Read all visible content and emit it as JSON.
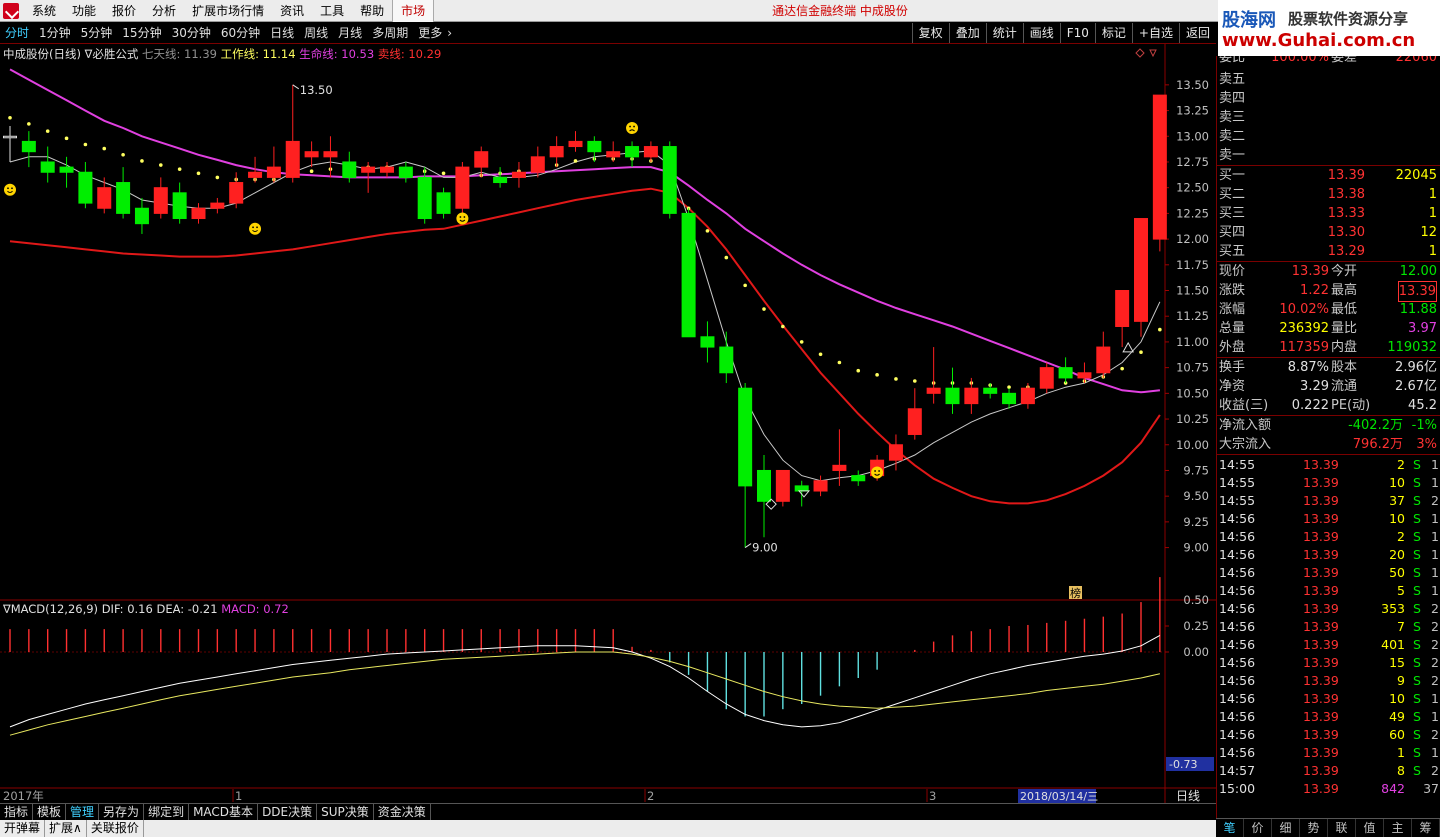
{
  "menu": {
    "items": [
      "系统",
      "功能",
      "报价",
      "分析",
      "扩展市场行情",
      "资讯",
      "工具",
      "帮助",
      "市场"
    ],
    "active": "市场",
    "title": "通达信金融终端  中成股份"
  },
  "watermark": {
    "logo": "股海网",
    "slogan": "股票软件资源分享",
    "url": "www.Guhai.com.cn"
  },
  "periods": [
    "分时",
    "1分钟",
    "5分钟",
    "15分钟",
    "30分钟",
    "60分钟",
    "日线",
    "周线",
    "月线",
    "多周期",
    "更多"
  ],
  "period_active": "分时",
  "tools": [
    "复权",
    "叠加",
    "统计",
    "画线",
    "F10",
    "标记",
    "+自选",
    "返回"
  ],
  "main_chart": {
    "stock": "中成股份(日线)",
    "formula": "∇必胜公式",
    "qitian": "七天线: 11.39",
    "gongzuo": "工作线: 11.14",
    "shengming": "生命线: 10.53",
    "maixian": "卖线: 10.29",
    "high_label": "13.50",
    "low_label": "9.00",
    "ylim": [
      8.5,
      13.8
    ],
    "yticks": [
      9.0,
      9.25,
      9.5,
      9.75,
      10.0,
      10.25,
      10.5,
      10.75,
      11.0,
      11.25,
      11.5,
      11.75,
      12.0,
      12.25,
      12.5,
      12.75,
      13.0,
      13.25,
      13.5
    ],
    "ytick_labels": [
      "9.00",
      "9.25",
      "9.50",
      "9.75",
      "10.00",
      "10.25",
      "10.50",
      "10.75",
      "11.00",
      "11.25",
      "11.50",
      "11.75",
      "12.00",
      "12.25",
      "12.50",
      "12.75",
      "13.00",
      "13.25",
      "13.50"
    ],
    "mark_label": "榜"
  },
  "macd": {
    "title": "∇MACD(12,26,9)",
    "dif": "DIF: 0.16",
    "dea": "DEA: -0.21",
    "macd": "MACD: 0.72",
    "ytick_labels": [
      "0.50",
      "0.25",
      "0.00"
    ],
    "cursor_label": "-0.73"
  },
  "xaxis": {
    "year_label": "2017年",
    "month_labels": [
      "1",
      "2",
      "3"
    ],
    "date_label": "2018/03/14/三",
    "period_label": "日线"
  },
  "chart_data": {
    "type": "candlestick",
    "colors": {
      "up": "#ff2020",
      "down": "#00ee00",
      "qitian": "#ffff60",
      "gongzuo": "#c8c8c8",
      "shengming": "#e040e0",
      "maixian": "#e01818"
    },
    "candles": [
      [
        13.0,
        13.0,
        13.1,
        12.75
      ],
      [
        12.95,
        12.85,
        13.05,
        12.7
      ],
      [
        12.75,
        12.65,
        12.9,
        12.55
      ],
      [
        12.7,
        12.65,
        12.8,
        12.5
      ],
      [
        12.65,
        12.35,
        12.75,
        12.3
      ],
      [
        12.3,
        12.5,
        12.6,
        12.25
      ],
      [
        12.55,
        12.25,
        12.7,
        12.2
      ],
      [
        12.3,
        12.15,
        12.4,
        12.05
      ],
      [
        12.25,
        12.5,
        12.6,
        12.2
      ],
      [
        12.45,
        12.2,
        12.55,
        12.15
      ],
      [
        12.2,
        12.3,
        12.35,
        12.15
      ],
      [
        12.3,
        12.35,
        12.4,
        12.25
      ],
      [
        12.35,
        12.55,
        12.65,
        12.3
      ],
      [
        12.6,
        12.65,
        12.8,
        12.55
      ],
      [
        12.6,
        12.7,
        12.9,
        12.55
      ],
      [
        12.6,
        12.95,
        13.5,
        12.55
      ],
      [
        12.8,
        12.85,
        12.95,
        12.7
      ],
      [
        12.8,
        12.85,
        13.0,
        12.6
      ],
      [
        12.75,
        12.6,
        12.85,
        12.55
      ],
      [
        12.65,
        12.7,
        12.75,
        12.45
      ],
      [
        12.65,
        12.7,
        12.75,
        12.6
      ],
      [
        12.7,
        12.6,
        12.75,
        12.55
      ],
      [
        12.6,
        12.2,
        12.7,
        12.15
      ],
      [
        12.45,
        12.25,
        12.5,
        12.2
      ],
      [
        12.3,
        12.7,
        12.75,
        12.25
      ],
      [
        12.7,
        12.85,
        12.9,
        12.6
      ],
      [
        12.6,
        12.55,
        12.7,
        12.5
      ],
      [
        12.6,
        12.65,
        12.75,
        12.5
      ],
      [
        12.65,
        12.8,
        12.9,
        12.6
      ],
      [
        12.8,
        12.9,
        13.0,
        12.7
      ],
      [
        12.9,
        12.95,
        13.05,
        12.85
      ],
      [
        12.95,
        12.85,
        13.0,
        12.75
      ],
      [
        12.8,
        12.85,
        12.95,
        12.75
      ],
      [
        12.9,
        12.8,
        12.95,
        12.7
      ],
      [
        12.8,
        12.9,
        12.95,
        12.75
      ],
      [
        12.9,
        12.25,
        12.95,
        12.2
      ],
      [
        12.25,
        11.05,
        12.3,
        11.05
      ],
      [
        11.05,
        10.95,
        11.2,
        10.8
      ],
      [
        10.95,
        10.7,
        11.1,
        10.6
      ],
      [
        10.55,
        9.6,
        10.6,
        9.0
      ],
      [
        9.75,
        9.45,
        9.9,
        9.1
      ],
      [
        9.45,
        9.75,
        9.75,
        9.4
      ],
      [
        9.6,
        9.55,
        9.65,
        9.4
      ],
      [
        9.55,
        9.65,
        9.7,
        9.5
      ],
      [
        9.75,
        9.8,
        10.15,
        9.6
      ],
      [
        9.7,
        9.65,
        9.75,
        9.6
      ],
      [
        9.7,
        9.85,
        9.9,
        9.65
      ],
      [
        9.85,
        10.0,
        10.1,
        9.75
      ],
      [
        10.1,
        10.35,
        10.55,
        10.05
      ],
      [
        10.5,
        10.55,
        10.95,
        10.4
      ],
      [
        10.55,
        10.4,
        10.75,
        10.3
      ],
      [
        10.4,
        10.55,
        10.65,
        10.3
      ],
      [
        10.55,
        10.5,
        10.6,
        10.45
      ],
      [
        10.5,
        10.4,
        10.55,
        10.35
      ],
      [
        10.4,
        10.55,
        10.6,
        10.35
      ],
      [
        10.55,
        10.75,
        10.8,
        10.5
      ],
      [
        10.75,
        10.65,
        10.85,
        10.6
      ],
      [
        10.65,
        10.7,
        10.8,
        10.6
      ],
      [
        10.7,
        10.95,
        11.1,
        10.65
      ],
      [
        11.15,
        11.5,
        11.5,
        10.95
      ],
      [
        11.2,
        12.2,
        12.2,
        11.05
      ],
      [
        12.0,
        13.4,
        13.4,
        11.88
      ]
    ],
    "qitian": [
      13.18,
      13.12,
      13.05,
      12.98,
      12.92,
      12.88,
      12.82,
      12.76,
      12.72,
      12.68,
      12.64,
      12.6,
      12.58,
      12.58,
      12.58,
      12.62,
      12.66,
      12.68,
      12.7,
      12.7,
      12.7,
      12.68,
      12.66,
      12.64,
      12.62,
      12.62,
      12.64,
      12.66,
      12.68,
      12.72,
      12.76,
      12.78,
      12.78,
      12.78,
      12.76,
      12.6,
      12.3,
      12.08,
      11.82,
      11.55,
      11.32,
      11.15,
      11.0,
      10.88,
      10.8,
      10.72,
      10.68,
      10.64,
      10.62,
      10.6,
      10.6,
      10.6,
      10.58,
      10.56,
      10.56,
      10.58,
      10.6,
      10.62,
      10.66,
      10.74,
      10.9,
      11.12
    ],
    "gongzuo": [
      12.75,
      12.8,
      12.8,
      12.72,
      12.62,
      12.55,
      12.48,
      12.38,
      12.35,
      12.32,
      12.3,
      12.3,
      12.35,
      12.45,
      12.55,
      12.65,
      12.72,
      12.75,
      12.72,
      12.68,
      12.7,
      12.75,
      12.7,
      12.6,
      12.6,
      12.65,
      12.6,
      12.6,
      12.62,
      12.68,
      12.75,
      12.8,
      12.82,
      12.84,
      12.86,
      12.72,
      12.2,
      11.6,
      11.0,
      10.45,
      10.1,
      9.85,
      9.7,
      9.65,
      9.68,
      9.7,
      9.75,
      9.82,
      9.9,
      10.02,
      10.12,
      10.22,
      10.3,
      10.36,
      10.42,
      10.5,
      10.56,
      10.6,
      10.68,
      10.8,
      11.0,
      11.39
    ],
    "shengming": [
      13.65,
      13.55,
      13.45,
      13.35,
      13.25,
      13.15,
      13.08,
      13.0,
      12.94,
      12.88,
      12.82,
      12.77,
      12.72,
      12.68,
      12.65,
      12.63,
      12.62,
      12.61,
      12.6,
      12.6,
      12.6,
      12.6,
      12.61,
      12.61,
      12.61,
      12.62,
      12.63,
      12.64,
      12.65,
      12.66,
      12.67,
      12.68,
      12.69,
      12.7,
      12.7,
      12.65,
      12.52,
      12.38,
      12.25,
      12.1,
      11.98,
      11.86,
      11.75,
      11.65,
      11.56,
      11.48,
      11.4,
      11.33,
      11.27,
      11.21,
      11.15,
      11.08,
      11.01,
      10.94,
      10.87,
      10.8,
      10.73,
      10.65,
      10.59,
      10.53,
      10.51,
      10.53
    ],
    "maixian": [
      11.98,
      11.96,
      11.94,
      11.92,
      11.9,
      11.88,
      11.86,
      11.85,
      11.84,
      11.83,
      11.83,
      11.83,
      11.84,
      11.86,
      11.88,
      11.9,
      11.93,
      11.96,
      11.99,
      12.02,
      12.05,
      12.07,
      12.09,
      12.1,
      12.14,
      12.18,
      12.22,
      12.26,
      12.3,
      12.34,
      12.38,
      12.41,
      12.44,
      12.47,
      12.49,
      12.45,
      12.3,
      12.12,
      11.9,
      11.65,
      11.4,
      11.16,
      10.93,
      10.7,
      10.5,
      10.3,
      10.12,
      9.95,
      9.8,
      9.67,
      9.58,
      9.5,
      9.45,
      9.43,
      9.43,
      9.46,
      9.52,
      9.6,
      9.7,
      9.83,
      10.02,
      10.29
    ],
    "macd_bars": [
      0.22,
      0.22,
      0.22,
      0.22,
      0.22,
      0.22,
      0.22,
      0.22,
      0.22,
      0.22,
      0.22,
      0.22,
      0.22,
      0.22,
      0.22,
      0.22,
      0.22,
      0.22,
      0.22,
      0.22,
      0.22,
      0.22,
      0.22,
      0.22,
      0.22,
      0.22,
      0.22,
      0.22,
      0.22,
      0.22,
      0.22,
      0.22,
      0.22,
      0.05,
      0.02,
      -0.1,
      -0.22,
      -0.38,
      -0.55,
      -0.62,
      -0.62,
      -0.55,
      -0.5,
      -0.42,
      -0.33,
      -0.25,
      -0.17,
      0.0,
      0.02,
      0.1,
      0.16,
      0.2,
      0.22,
      0.25,
      0.26,
      0.28,
      0.3,
      0.32,
      0.34,
      0.37,
      0.48,
      0.72
    ],
    "dif": [
      -0.72,
      -0.65,
      -0.6,
      -0.55,
      -0.5,
      -0.46,
      -0.42,
      -0.38,
      -0.34,
      -0.3,
      -0.27,
      -0.24,
      -0.21,
      -0.18,
      -0.15,
      -0.12,
      -0.1,
      -0.08,
      -0.06,
      -0.04,
      -0.02,
      -0.01,
      0.0,
      0.01,
      0.02,
      0.03,
      0.04,
      0.05,
      0.06,
      0.06,
      0.06,
      0.05,
      0.04,
      0.0,
      -0.06,
      -0.14,
      -0.25,
      -0.38,
      -0.5,
      -0.6,
      -0.66,
      -0.7,
      -0.72,
      -0.71,
      -0.68,
      -0.62,
      -0.56,
      -0.5,
      -0.44,
      -0.38,
      -0.32,
      -0.26,
      -0.21,
      -0.17,
      -0.13,
      -0.1,
      -0.07,
      -0.04,
      -0.02,
      0.01,
      0.06,
      0.16
    ],
    "dea": [
      -0.8,
      -0.75,
      -0.7,
      -0.66,
      -0.62,
      -0.58,
      -0.54,
      -0.5,
      -0.46,
      -0.42,
      -0.39,
      -0.36,
      -0.33,
      -0.3,
      -0.27,
      -0.24,
      -0.22,
      -0.2,
      -0.17,
      -0.15,
      -0.13,
      -0.11,
      -0.09,
      -0.07,
      -0.06,
      -0.05,
      -0.04,
      -0.03,
      -0.02,
      -0.01,
      0.0,
      0.0,
      0.0,
      -0.02,
      -0.05,
      -0.09,
      -0.14,
      -0.2,
      -0.26,
      -0.32,
      -0.38,
      -0.43,
      -0.47,
      -0.5,
      -0.52,
      -0.53,
      -0.54,
      -0.53,
      -0.52,
      -0.5,
      -0.48,
      -0.46,
      -0.44,
      -0.42,
      -0.4,
      -0.37,
      -0.35,
      -0.33,
      -0.31,
      -0.28,
      -0.25,
      -0.21
    ],
    "smileys": [
      {
        "i": 0,
        "v": 12.48
      },
      {
        "i": 13,
        "v": 12.1
      },
      {
        "i": 24,
        "v": 12.2
      },
      {
        "i": 33,
        "v": 13.08
      },
      {
        "i": 46,
        "v": 9.73
      }
    ]
  },
  "quote": {
    "weibi": {
      "label": "委比",
      "value": "100.00%",
      "label2": "委差",
      "value2": "22060"
    },
    "sell": [
      {
        "label": "卖五",
        "price": "",
        "vol": ""
      },
      {
        "label": "卖四",
        "price": "",
        "vol": ""
      },
      {
        "label": "卖三",
        "price": "",
        "vol": ""
      },
      {
        "label": "卖二",
        "price": "",
        "vol": ""
      },
      {
        "label": "卖一",
        "price": "",
        "vol": ""
      }
    ],
    "buy": [
      {
        "label": "买一",
        "price": "13.39",
        "vol": "22045"
      },
      {
        "label": "买二",
        "price": "13.38",
        "vol": "1"
      },
      {
        "label": "买三",
        "price": "13.33",
        "vol": "1"
      },
      {
        "label": "买四",
        "price": "13.30",
        "vol": "12"
      },
      {
        "label": "买五",
        "price": "13.29",
        "vol": "1"
      }
    ],
    "stats": [
      {
        "l1": "现价",
        "v1": "13.39",
        "c1": "red",
        "l2": "今开",
        "v2": "12.00",
        "c2": "green"
      },
      {
        "l1": "涨跌",
        "v1": "1.22",
        "c1": "red",
        "l2": "最高",
        "v2": "13.39",
        "c2": "red"
      },
      {
        "l1": "涨幅",
        "v1": "10.02%",
        "c1": "red",
        "l2": "最低",
        "v2": "11.88",
        "c2": "green"
      },
      {
        "l1": "总量",
        "v1": "236392",
        "c1": "yellow",
        "l2": "量比",
        "v2": "3.97",
        "c2": "purple"
      },
      {
        "l1": "外盘",
        "v1": "117359",
        "c1": "red",
        "l2": "内盘",
        "v2": "119032",
        "c2": "green"
      }
    ],
    "stats2": [
      {
        "l1": "换手",
        "v1": "8.87%",
        "l2": "股本",
        "v2": "2.96亿"
      },
      {
        "l1": "净资",
        "v1": "3.29",
        "l2": "流通",
        "v2": "2.67亿"
      },
      {
        "l1": "收益(三)",
        "v1": "0.222",
        "l2": "PE(动)",
        "v2": "45.2"
      }
    ],
    "flow": [
      {
        "label": "净流入额",
        "value": "-402.2万",
        "pct": "-1%",
        "vc": "green",
        "pc": "green"
      },
      {
        "label": "大宗流入",
        "value": "796.2万",
        "pct": "3%",
        "vc": "red",
        "pc": "red"
      }
    ],
    "ticks": [
      {
        "t": "14:55",
        "p": "13.39",
        "v": "2",
        "s": "S",
        "n": "1"
      },
      {
        "t": "14:55",
        "p": "13.39",
        "v": "10",
        "s": "S",
        "n": "1"
      },
      {
        "t": "14:55",
        "p": "13.39",
        "v": "37",
        "s": "S",
        "n": "2"
      },
      {
        "t": "14:56",
        "p": "13.39",
        "v": "10",
        "s": "S",
        "n": "1"
      },
      {
        "t": "14:56",
        "p": "13.39",
        "v": "2",
        "s": "S",
        "n": "1"
      },
      {
        "t": "14:56",
        "p": "13.39",
        "v": "20",
        "s": "S",
        "n": "1"
      },
      {
        "t": "14:56",
        "p": "13.39",
        "v": "50",
        "s": "S",
        "n": "1"
      },
      {
        "t": "14:56",
        "p": "13.39",
        "v": "5",
        "s": "S",
        "n": "1"
      },
      {
        "t": "14:56",
        "p": "13.39",
        "v": "353",
        "s": "S",
        "n": "2"
      },
      {
        "t": "14:56",
        "p": "13.39",
        "v": "7",
        "s": "S",
        "n": "2"
      },
      {
        "t": "14:56",
        "p": "13.39",
        "v": "401",
        "s": "S",
        "n": "2"
      },
      {
        "t": "14:56",
        "p": "13.39",
        "v": "15",
        "s": "S",
        "n": "2"
      },
      {
        "t": "14:56",
        "p": "13.39",
        "v": "9",
        "s": "S",
        "n": "2"
      },
      {
        "t": "14:56",
        "p": "13.39",
        "v": "10",
        "s": "S",
        "n": "1"
      },
      {
        "t": "14:56",
        "p": "13.39",
        "v": "49",
        "s": "S",
        "n": "1"
      },
      {
        "t": "14:56",
        "p": "13.39",
        "v": "60",
        "s": "S",
        "n": "2"
      },
      {
        "t": "14:56",
        "p": "13.39",
        "v": "1",
        "s": "S",
        "n": "1"
      },
      {
        "t": "14:57",
        "p": "13.39",
        "v": "8",
        "s": "S",
        "n": "2"
      },
      {
        "t": "15:00",
        "p": "13.39",
        "v": "842",
        "s": "",
        "n": "37"
      }
    ],
    "tabs": [
      "笔",
      "价",
      "细",
      "势",
      "联",
      "值",
      "主",
      "筹"
    ]
  },
  "indicator_tabs": [
    "指标",
    "模板",
    "管理",
    "另存为",
    "绑定到",
    "MACD基本",
    "DDE决策",
    "SUP决策",
    "资金决策"
  ],
  "indicator_active": "管理",
  "status_tabs": [
    "开弹幕",
    "扩展∧",
    "关联报价"
  ]
}
